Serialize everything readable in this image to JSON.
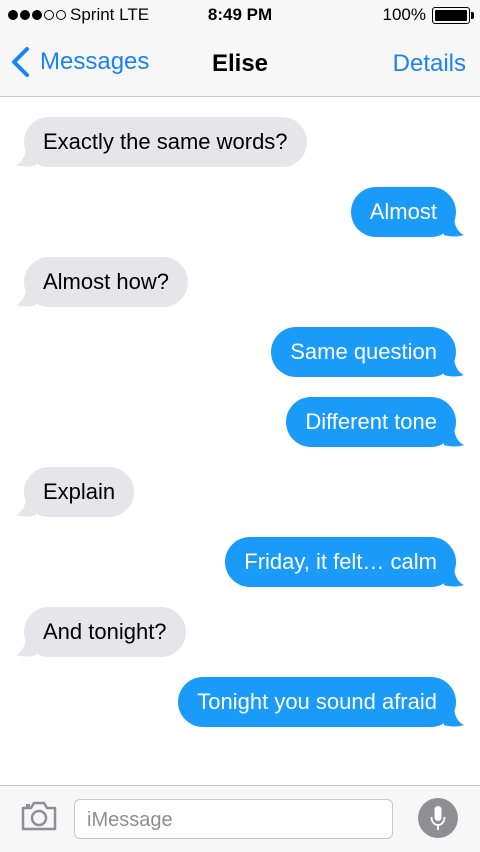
{
  "status_bar": {
    "signal_filled": 3,
    "signal_total": 5,
    "carrier": "Sprint  LTE",
    "time": "8:49 PM",
    "battery_percent": "100%",
    "battery_level": 1.0
  },
  "nav": {
    "back_label": "Messages",
    "title": "Elise",
    "details_label": "Details"
  },
  "colors": {
    "accent": "#1a82fb",
    "outgoing_bubble": "#1a9bf9",
    "incoming_bubble": "#e5e5ea"
  },
  "messages": [
    {
      "direction": "in",
      "text": "Exactly the same words?"
    },
    {
      "direction": "out",
      "text": "Almost"
    },
    {
      "direction": "in",
      "text": "Almost how?"
    },
    {
      "direction": "out",
      "text": "Same question"
    },
    {
      "direction": "out",
      "text": "Different tone"
    },
    {
      "direction": "in",
      "text": "Explain"
    },
    {
      "direction": "out",
      "text": "Friday, it felt… calm"
    },
    {
      "direction": "in",
      "text": "And tonight?"
    },
    {
      "direction": "out",
      "text": "Tonight you sound afraid"
    }
  ],
  "input": {
    "placeholder": "iMessage",
    "camera_icon": "camera-icon",
    "mic_icon": "microphone-icon"
  }
}
